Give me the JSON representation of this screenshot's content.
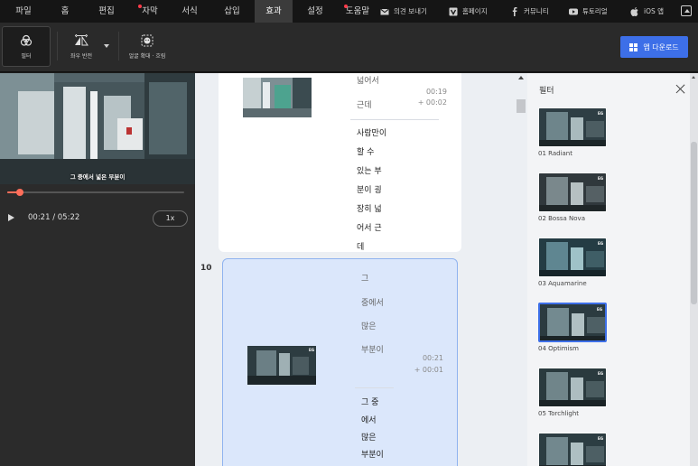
{
  "menu": {
    "items": [
      {
        "label": "파일",
        "dot": false,
        "active": false
      },
      {
        "label": "홈",
        "dot": false,
        "active": false
      },
      {
        "label": "편집",
        "dot": false,
        "active": false
      },
      {
        "label": "자막",
        "dot": true,
        "active": false
      },
      {
        "label": "서식",
        "dot": false,
        "active": false
      },
      {
        "label": "삽입",
        "dot": false,
        "active": false
      },
      {
        "label": "효과",
        "dot": false,
        "active": true
      },
      {
        "label": "설정",
        "dot": false,
        "active": false
      },
      {
        "label": "도움말",
        "dot": true,
        "active": false
      }
    ],
    "links": {
      "feedback": "의견 보내기",
      "homepage": "홈페이지",
      "community": "커뮤니티",
      "tutorial": "튜토리얼",
      "ios": "iOS 앱"
    }
  },
  "toolbar": {
    "filter": "필터",
    "flip": "좌우 반전",
    "face_blur": "얼굴 확대 · 흐림",
    "download": "앱 다운로드"
  },
  "player": {
    "subtitle": "그 중에서 넓은 부분이",
    "time": "00:21 / 05:22",
    "speed": "1x",
    "progress": 0.07
  },
  "segments": {
    "prev": {
      "lines": [
        "넓어서",
        "근데"
      ],
      "time": "00:19",
      "duration": "+ 00:02",
      "edit_lines": [
        "사람만이",
        "할 수",
        "있는 부",
        "분이 굉",
        "장히 넓",
        "어서 근",
        "데"
      ]
    },
    "current": {
      "number": "10",
      "lines": [
        "그",
        "중에서",
        "많은",
        "부분이"
      ],
      "time": "00:21",
      "duration": "+ 00:01",
      "edit_lines": [
        "그 중",
        "에서",
        "많은",
        "부분이"
      ]
    }
  },
  "filters": {
    "title": "필터",
    "items": [
      {
        "label": "01 Radiant"
      },
      {
        "label": "02 Bossa Nova"
      },
      {
        "label": "03 Aquamarine"
      },
      {
        "label": "04 Optimism",
        "selected": true
      },
      {
        "label": "05 Torchlight"
      },
      {
        "label": ""
      }
    ],
    "badge": "EG",
    "selected_color": "#3d6fe8"
  }
}
